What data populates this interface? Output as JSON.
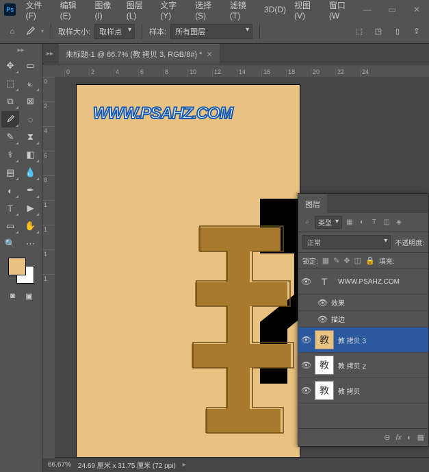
{
  "app": {
    "logo": "Ps"
  },
  "menu": [
    "文件(F)",
    "编辑(E)",
    "图像(I)",
    "图层(L)",
    "文字(Y)",
    "选择(S)",
    "滤镜(T)",
    "3D(D)",
    "视图(V)",
    "窗口(W"
  ],
  "win_controls": {
    "min": "—",
    "max": "▭",
    "close": "✕"
  },
  "options": {
    "sample_size_label": "取样大小:",
    "sample_size_value": "取样点",
    "sample_label": "样本:",
    "sample_value": "所有图层"
  },
  "document_tab": "未标题-1 @ 66.7% (教 拷贝 3, RGB/8#) *",
  "ruler_h": [
    "0",
    "2",
    "4",
    "6",
    "8",
    "10",
    "12",
    "14",
    "16",
    "18",
    "20",
    "22",
    "24"
  ],
  "ruler_v": [
    "0",
    "2",
    "4",
    "6",
    "8",
    "1",
    "1",
    "1",
    "1"
  ],
  "watermark": "WWW.PSAHZ.COM",
  "status": {
    "zoom": "66.67%",
    "dims": "24.69 厘米 x 31.75 厘米 (72 ppi)"
  },
  "colors": {
    "fg": "#e9c281",
    "bg": "#ffffff",
    "accent": "#1a5bb0"
  },
  "layers_panel": {
    "title": "图层",
    "filter_kind": "类型",
    "blend_mode": "正常",
    "opacity_label": "不透明度:",
    "lock_label": "锁定:",
    "fill_label": "填充:",
    "layers": [
      {
        "type": "text",
        "name": "WWW.PSAHZ.COM",
        "vis": true
      },
      {
        "type": "fx",
        "name": "效果",
        "vis": true
      },
      {
        "type": "fxitem",
        "name": "描边",
        "vis": true
      },
      {
        "type": "bitmap",
        "name": "教 拷贝 3",
        "vis": true,
        "selected": true
      },
      {
        "type": "bitmap",
        "name": "教 拷贝 2",
        "vis": true
      },
      {
        "type": "bitmap",
        "name": "教 拷贝",
        "vis": true
      }
    ],
    "bottom_icons": [
      "⊖",
      "fx",
      "◐",
      "▦",
      "◧",
      "⊕"
    ]
  }
}
